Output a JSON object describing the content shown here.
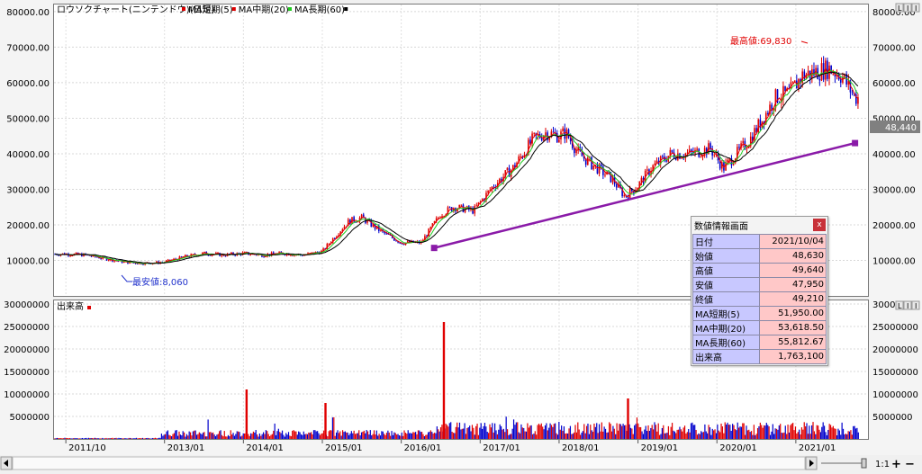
{
  "price_panel": {
    "legend_title": "ロウソクチャート(ニンテンドウ)(日足)",
    "legend_items": [
      {
        "label": "MA短期(5)",
        "color": "#e00000"
      },
      {
        "label": "MA中期(20)",
        "color": "#e00000"
      },
      {
        "label": "MA長期(60)",
        "color": "#22cc22"
      },
      {
        "label": "",
        "color": "#000000"
      }
    ],
    "high_label": "最高値:69,830",
    "low_label": "最安値:8,060",
    "last_price_tag": "48,440"
  },
  "volume_panel": {
    "legend_title": "出来高",
    "legend_color": "#e00000"
  },
  "axis_buttons": [
    "L",
    "I",
    "I"
  ],
  "info_box": {
    "title": "数値情報画面",
    "close_label": "x",
    "rows": [
      {
        "key": "日付",
        "value": "2021/10/04"
      },
      {
        "key": "始値",
        "value": "48,630"
      },
      {
        "key": "高値",
        "value": "49,640"
      },
      {
        "key": "安値",
        "value": "47,950"
      },
      {
        "key": "終値",
        "value": "49,210"
      },
      {
        "key": "MA短期(5)",
        "value": "51,950.00"
      },
      {
        "key": "MA中期(20)",
        "value": "53,618.50"
      },
      {
        "key": "MA長期(60)",
        "value": "55,812.67"
      },
      {
        "key": "出来高",
        "value": "1,763,100"
      }
    ]
  },
  "bottom_bar": {
    "ratio_label": "1:1",
    "zoom_in": "+",
    "zoom_out": "−"
  },
  "colors": {
    "up": "#e00000",
    "down": "#0000cc",
    "trendline": "#8a1aa8",
    "ma_short": "#e00000",
    "ma_mid": "#e00000",
    "ma_long": "#22cc22",
    "ma_black": "#000000"
  },
  "chart_data": [
    {
      "type": "line",
      "title": "ロウソクチャート(ニンテンドウ)(日足)",
      "x_tick_labels": [
        "2011/10",
        "2013/01",
        "2014/01",
        "2015/01",
        "2016/01",
        "2017/01",
        "2018/01",
        "2019/01",
        "2020/01",
        "2021/01"
      ],
      "ylim": [
        0,
        82000
      ],
      "y_tick_values": [
        10000,
        20000,
        30000,
        40000,
        50000,
        60000,
        70000,
        80000
      ],
      "y_tick_labels": [
        "10000.00",
        "20000.00",
        "30000.00",
        "40000.00",
        "50000.00",
        "60000.00",
        "70000.00",
        "80000.00"
      ],
      "series": [
        {
          "name": "MA長期(60)",
          "x": [
            "2011/10",
            "2012/01",
            "2012/04",
            "2012/07",
            "2012/10",
            "2013/01",
            "2013/04",
            "2013/07",
            "2013/10",
            "2014/01",
            "2014/04",
            "2014/07",
            "2014/10",
            "2015/01",
            "2015/03",
            "2015/05",
            "2015/07",
            "2015/10",
            "2016/01",
            "2016/04",
            "2016/07",
            "2016/09",
            "2016/12",
            "2017/03",
            "2017/06",
            "2017/09",
            "2017/11",
            "2018/01",
            "2018/02",
            "2018/04",
            "2018/06",
            "2018/09",
            "2018/11",
            "2019/01",
            "2019/03",
            "2019/06",
            "2019/09",
            "2019/12",
            "2020/02",
            "2020/04",
            "2020/06",
            "2020/08",
            "2020/10",
            "2020/12",
            "2021/02",
            "2021/04",
            "2021/06",
            "2021/08",
            "2021/10"
          ],
          "y": [
            11800,
            11500,
            10500,
            9500,
            9200,
            9500,
            11000,
            12000,
            11500,
            12000,
            11500,
            12000,
            11500,
            12500,
            17000,
            21000,
            22000,
            18000,
            15000,
            15000,
            23000,
            25000,
            24000,
            31000,
            36000,
            44000,
            46000,
            45000,
            46000,
            40000,
            37000,
            33000,
            28000,
            31000,
            36000,
            40000,
            40000,
            41500,
            36000,
            40000,
            44000,
            50000,
            56000,
            57000,
            62000,
            63000,
            64000,
            62000,
            55800
          ]
        }
      ],
      "annotations": [
        {
          "text": "最高値:69,830",
          "value": 69830
        },
        {
          "text": "最安値:8,060",
          "value": 8060
        }
      ],
      "trendline": {
        "start_x": "2016/06",
        "start_y": 13500,
        "end_x": "2021/10",
        "end_y": 43000
      }
    },
    {
      "type": "bar",
      "title": "出来高",
      "x_tick_labels": [
        "2011/10",
        "2013/01",
        "2014/01",
        "2015/01",
        "2016/01",
        "2017/01",
        "2018/01",
        "2019/01",
        "2020/01",
        "2021/01"
      ],
      "ylim": [
        0,
        30000000
      ],
      "y_tick_values": [
        5000000,
        10000000,
        15000000,
        20000000,
        25000000,
        30000000
      ],
      "y_tick_labels": [
        "5000000",
        "10000000",
        "15000000",
        "20000000",
        "25000000",
        "30000000"
      ],
      "spikes": [
        {
          "x": "2014/01",
          "value": 11000000
        },
        {
          "x": "2015/01",
          "value": 8000000
        },
        {
          "x": "2016/07",
          "value": 26000000
        },
        {
          "x": "2018/11",
          "value": 9000000
        }
      ]
    }
  ]
}
